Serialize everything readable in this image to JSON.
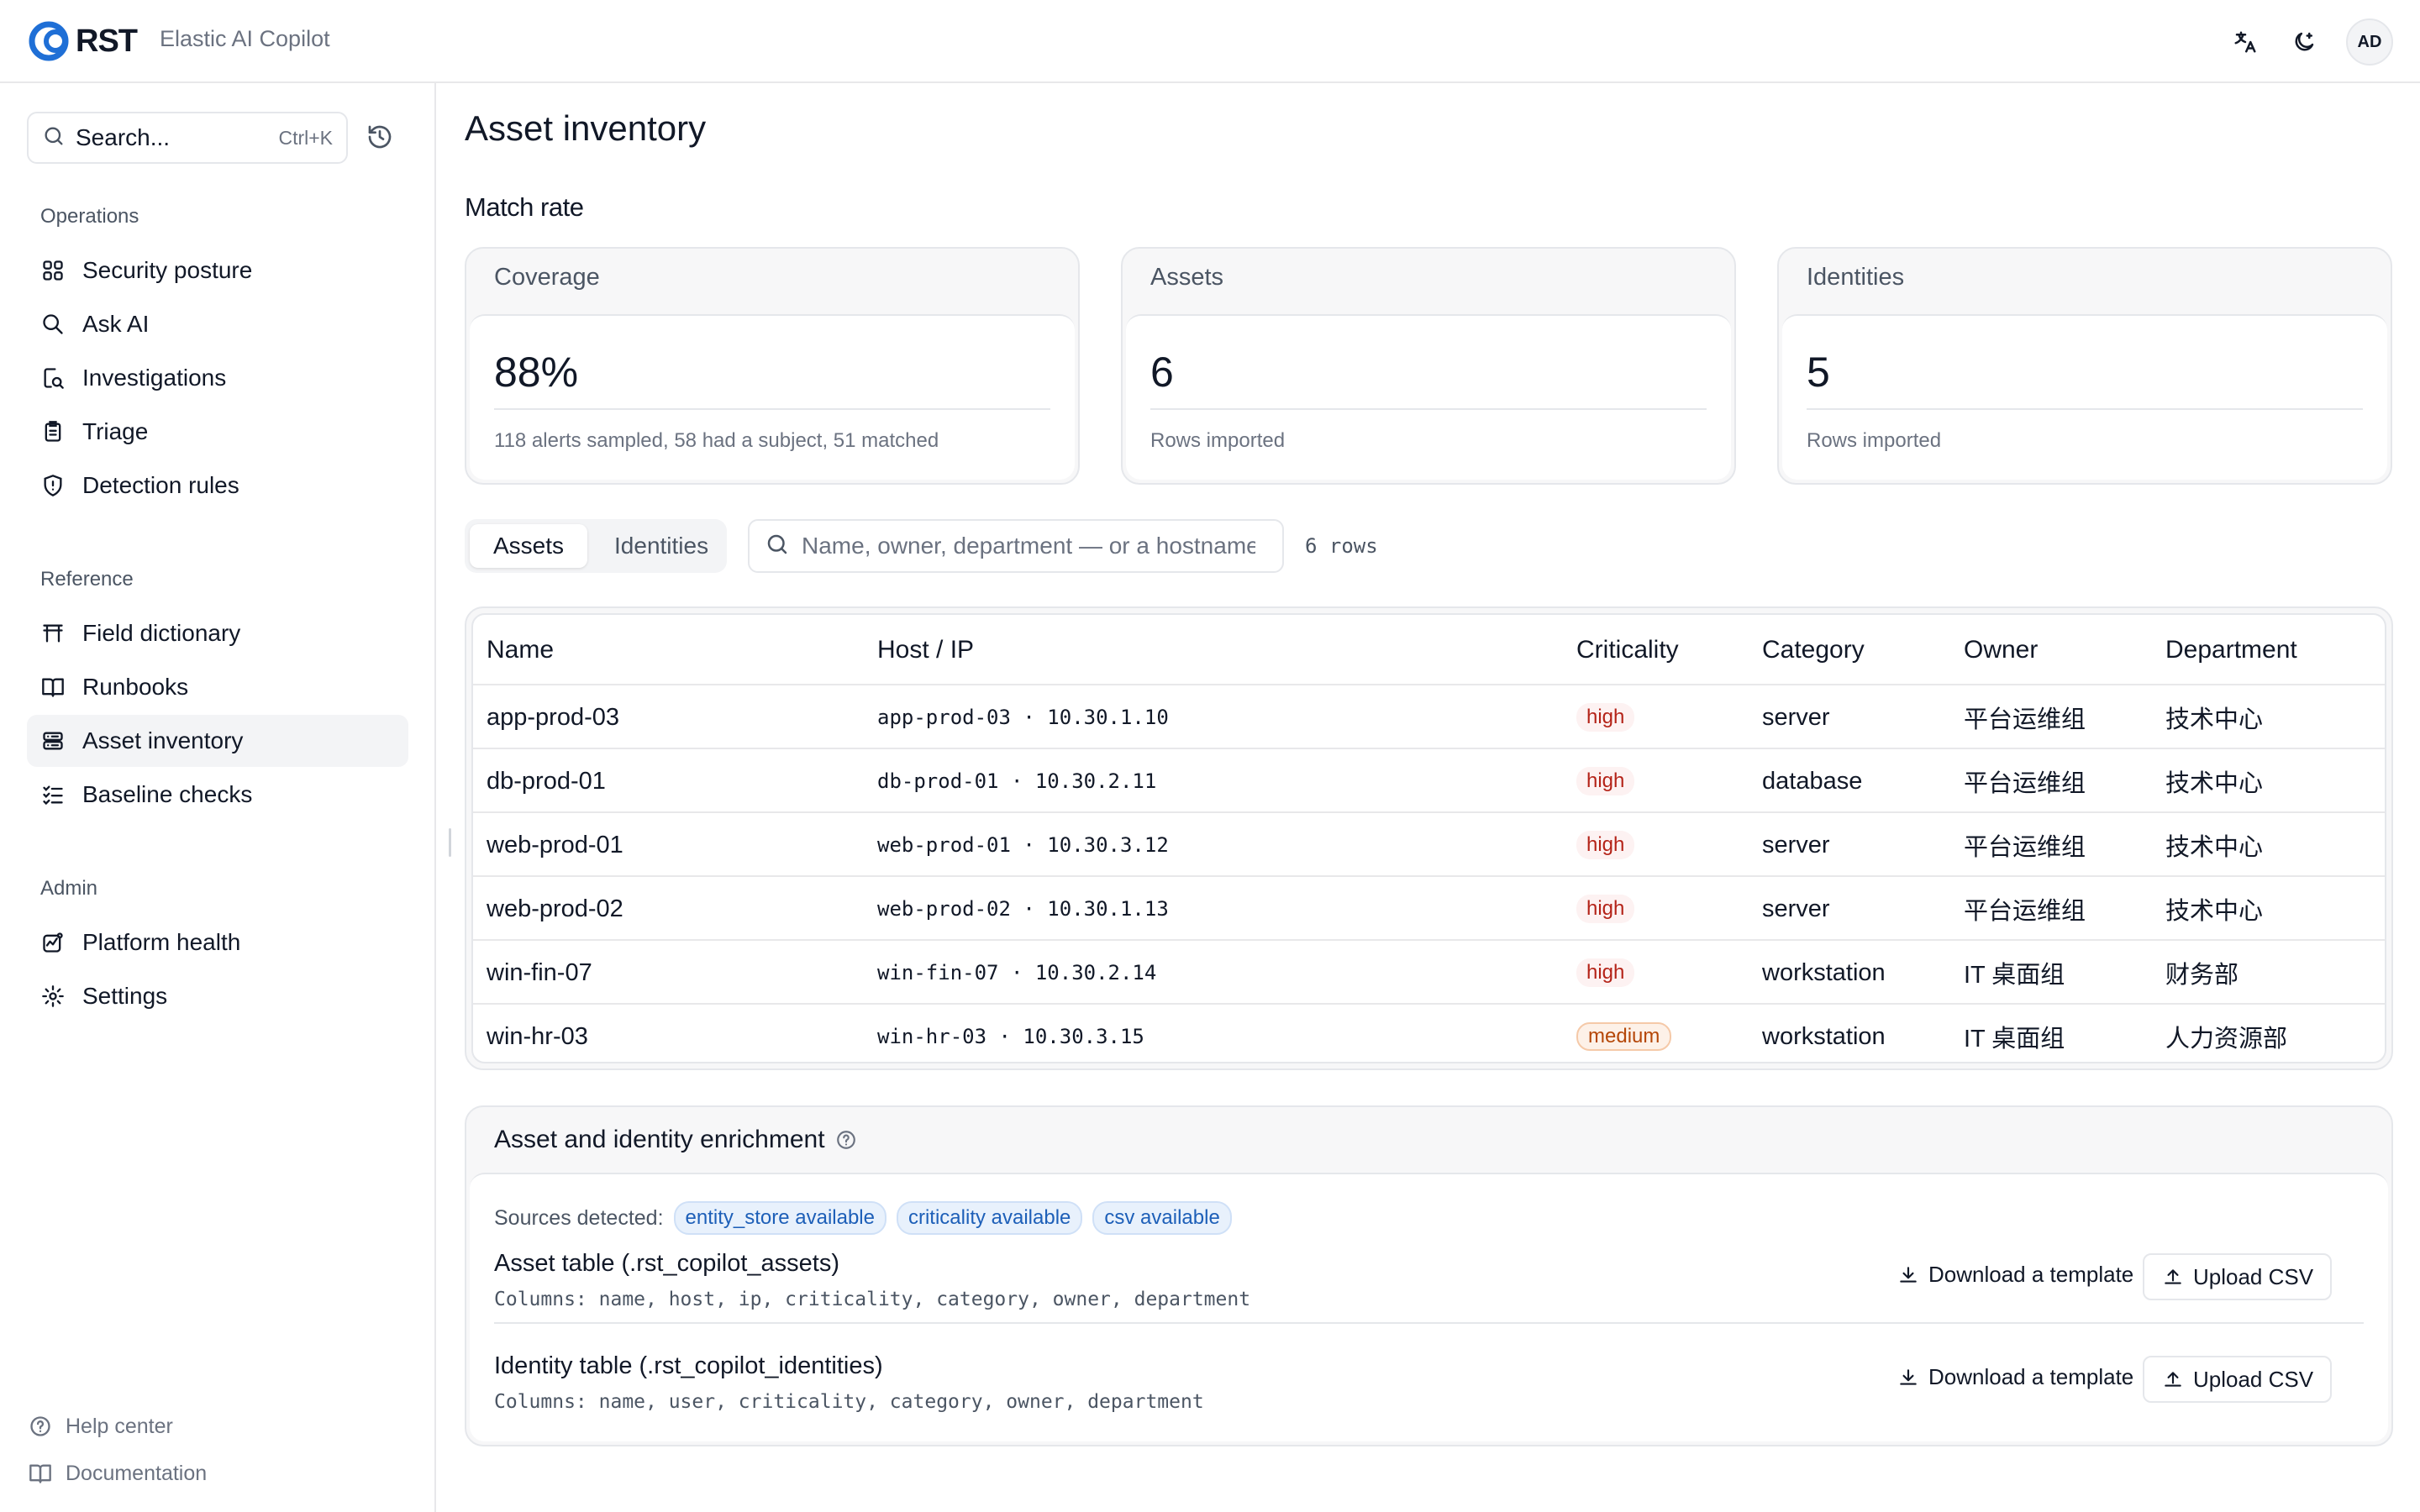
{
  "header": {
    "brand": "RST",
    "app_name": "Elastic AI Copilot",
    "avatar_initials": "AD"
  },
  "sidebar": {
    "search_label": "Search...",
    "search_shortcut": "Ctrl+K",
    "sections": [
      {
        "label": "Operations",
        "items": [
          {
            "label": "Security posture",
            "icon": "grid-icon"
          },
          {
            "label": "Ask AI",
            "icon": "search-icon"
          },
          {
            "label": "Investigations",
            "icon": "investigation-icon"
          },
          {
            "label": "Triage",
            "icon": "clipboard-icon"
          },
          {
            "label": "Detection rules",
            "icon": "shield-icon"
          }
        ]
      },
      {
        "label": "Reference",
        "items": [
          {
            "label": "Field dictionary",
            "icon": "table-icon"
          },
          {
            "label": "Runbooks",
            "icon": "book-open-icon"
          },
          {
            "label": "Asset inventory",
            "icon": "server-icon",
            "active": true
          },
          {
            "label": "Baseline checks",
            "icon": "list-check-icon"
          }
        ]
      },
      {
        "label": "Admin",
        "items": [
          {
            "label": "Platform health",
            "icon": "activity-icon"
          },
          {
            "label": "Settings",
            "icon": "gear-icon"
          }
        ]
      }
    ],
    "footer": [
      {
        "label": "Help center",
        "icon": "help-icon"
      },
      {
        "label": "Documentation",
        "icon": "book-icon"
      }
    ]
  },
  "main": {
    "title": "Asset inventory",
    "section_title": "Match rate",
    "cards": [
      {
        "title": "Coverage",
        "value": "88%",
        "sub": "118 alerts sampled, 58 had a subject, 51 matched"
      },
      {
        "title": "Assets",
        "value": "6",
        "sub": "Rows imported"
      },
      {
        "title": "Identities",
        "value": "5",
        "sub": "Rows imported"
      }
    ],
    "tabs": [
      "Assets",
      "Identities"
    ],
    "active_tab": "Assets",
    "filter_placeholder": "Name, owner, department — or a hostname",
    "row_count": "6 rows",
    "table": {
      "columns": [
        "Name",
        "Host / IP",
        "Criticality",
        "Category",
        "Owner",
        "Department"
      ],
      "rows": [
        {
          "name": "app-prod-03",
          "host": "app-prod-03 · 10.30.1.10",
          "criticality": "high",
          "category": "server",
          "owner": "平台运维组",
          "department": "技术中心"
        },
        {
          "name": "db-prod-01",
          "host": "db-prod-01 · 10.30.2.11",
          "criticality": "high",
          "category": "database",
          "owner": "平台运维组",
          "department": "技术中心"
        },
        {
          "name": "web-prod-01",
          "host": "web-prod-01 · 10.30.3.12",
          "criticality": "high",
          "category": "server",
          "owner": "平台运维组",
          "department": "技术中心"
        },
        {
          "name": "web-prod-02",
          "host": "web-prod-02 · 10.30.1.13",
          "criticality": "high",
          "category": "server",
          "owner": "平台运维组",
          "department": "技术中心"
        },
        {
          "name": "win-fin-07",
          "host": "win-fin-07 · 10.30.2.14",
          "criticality": "high",
          "category": "workstation",
          "owner": "IT 桌面组",
          "department": "财务部"
        },
        {
          "name": "win-hr-03",
          "host": "win-hr-03 · 10.30.3.15",
          "criticality": "medium",
          "category": "workstation",
          "owner": "IT 桌面组",
          "department": "人力资源部"
        }
      ]
    },
    "enrichment": {
      "title": "Asset and identity enrichment",
      "sources_label": "Sources detected:",
      "sources": [
        "entity_store available",
        "criticality available",
        "csv available"
      ],
      "tables": [
        {
          "title": "Asset table (.rst_copilot_assets)",
          "columns": "Columns: name, host, ip, criticality, category, owner, department"
        },
        {
          "title": "Identity table (.rst_copilot_identities)",
          "columns": "Columns: name, user, criticality, category, owner, department"
        }
      ],
      "download_label": "Download a template",
      "upload_label": "Upload CSV"
    }
  },
  "colors": {
    "brand_blue": "#1f6fd6",
    "high_badge": "#b42318",
    "medium_badge": "#b54708",
    "chip_blue": "#1d5fb8"
  }
}
